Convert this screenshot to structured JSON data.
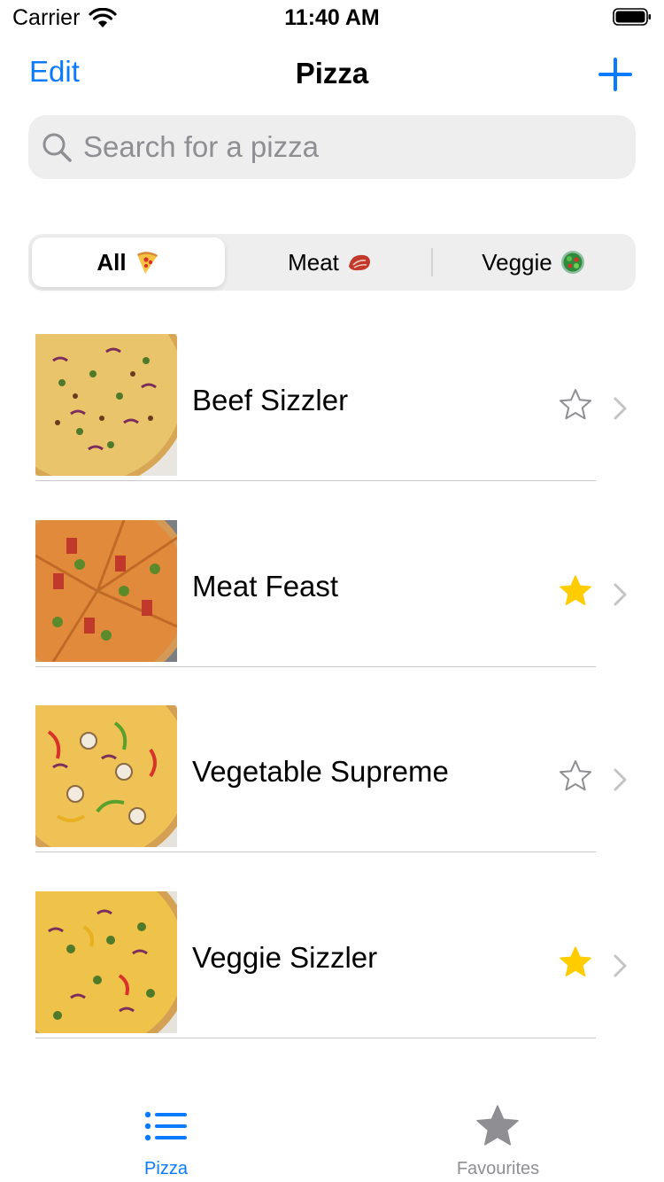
{
  "status_bar": {
    "carrier": "Carrier",
    "time": "11:40 AM"
  },
  "nav": {
    "edit_label": "Edit",
    "title": "Pizza",
    "add_icon": "plus-icon"
  },
  "search": {
    "placeholder": "Search for a pizza",
    "value": ""
  },
  "segments": [
    {
      "label": "All",
      "icon": "pizza-slice-emoji",
      "selected": true
    },
    {
      "label": "Meat",
      "icon": "meat-emoji",
      "selected": false
    },
    {
      "label": "Veggie",
      "icon": "salad-emoji",
      "selected": false
    }
  ],
  "pizzas": [
    {
      "name": "Beef Sizzler",
      "favourite": false
    },
    {
      "name": "Meat Feast",
      "favourite": true
    },
    {
      "name": "Vegetable Supreme",
      "favourite": false
    },
    {
      "name": "Veggie Sizzler",
      "favourite": true
    }
  ],
  "tabs": [
    {
      "label": "Pizza",
      "icon": "list-icon",
      "selected": true
    },
    {
      "label": "Favourites",
      "icon": "star-icon",
      "selected": false
    }
  ],
  "colors": {
    "accent": "#0a7aff",
    "star_filled": "#ffcc00",
    "star_outline": "#8e8e93",
    "tab_inactive": "#8e8e93",
    "chevron": "#c4c4c7"
  }
}
